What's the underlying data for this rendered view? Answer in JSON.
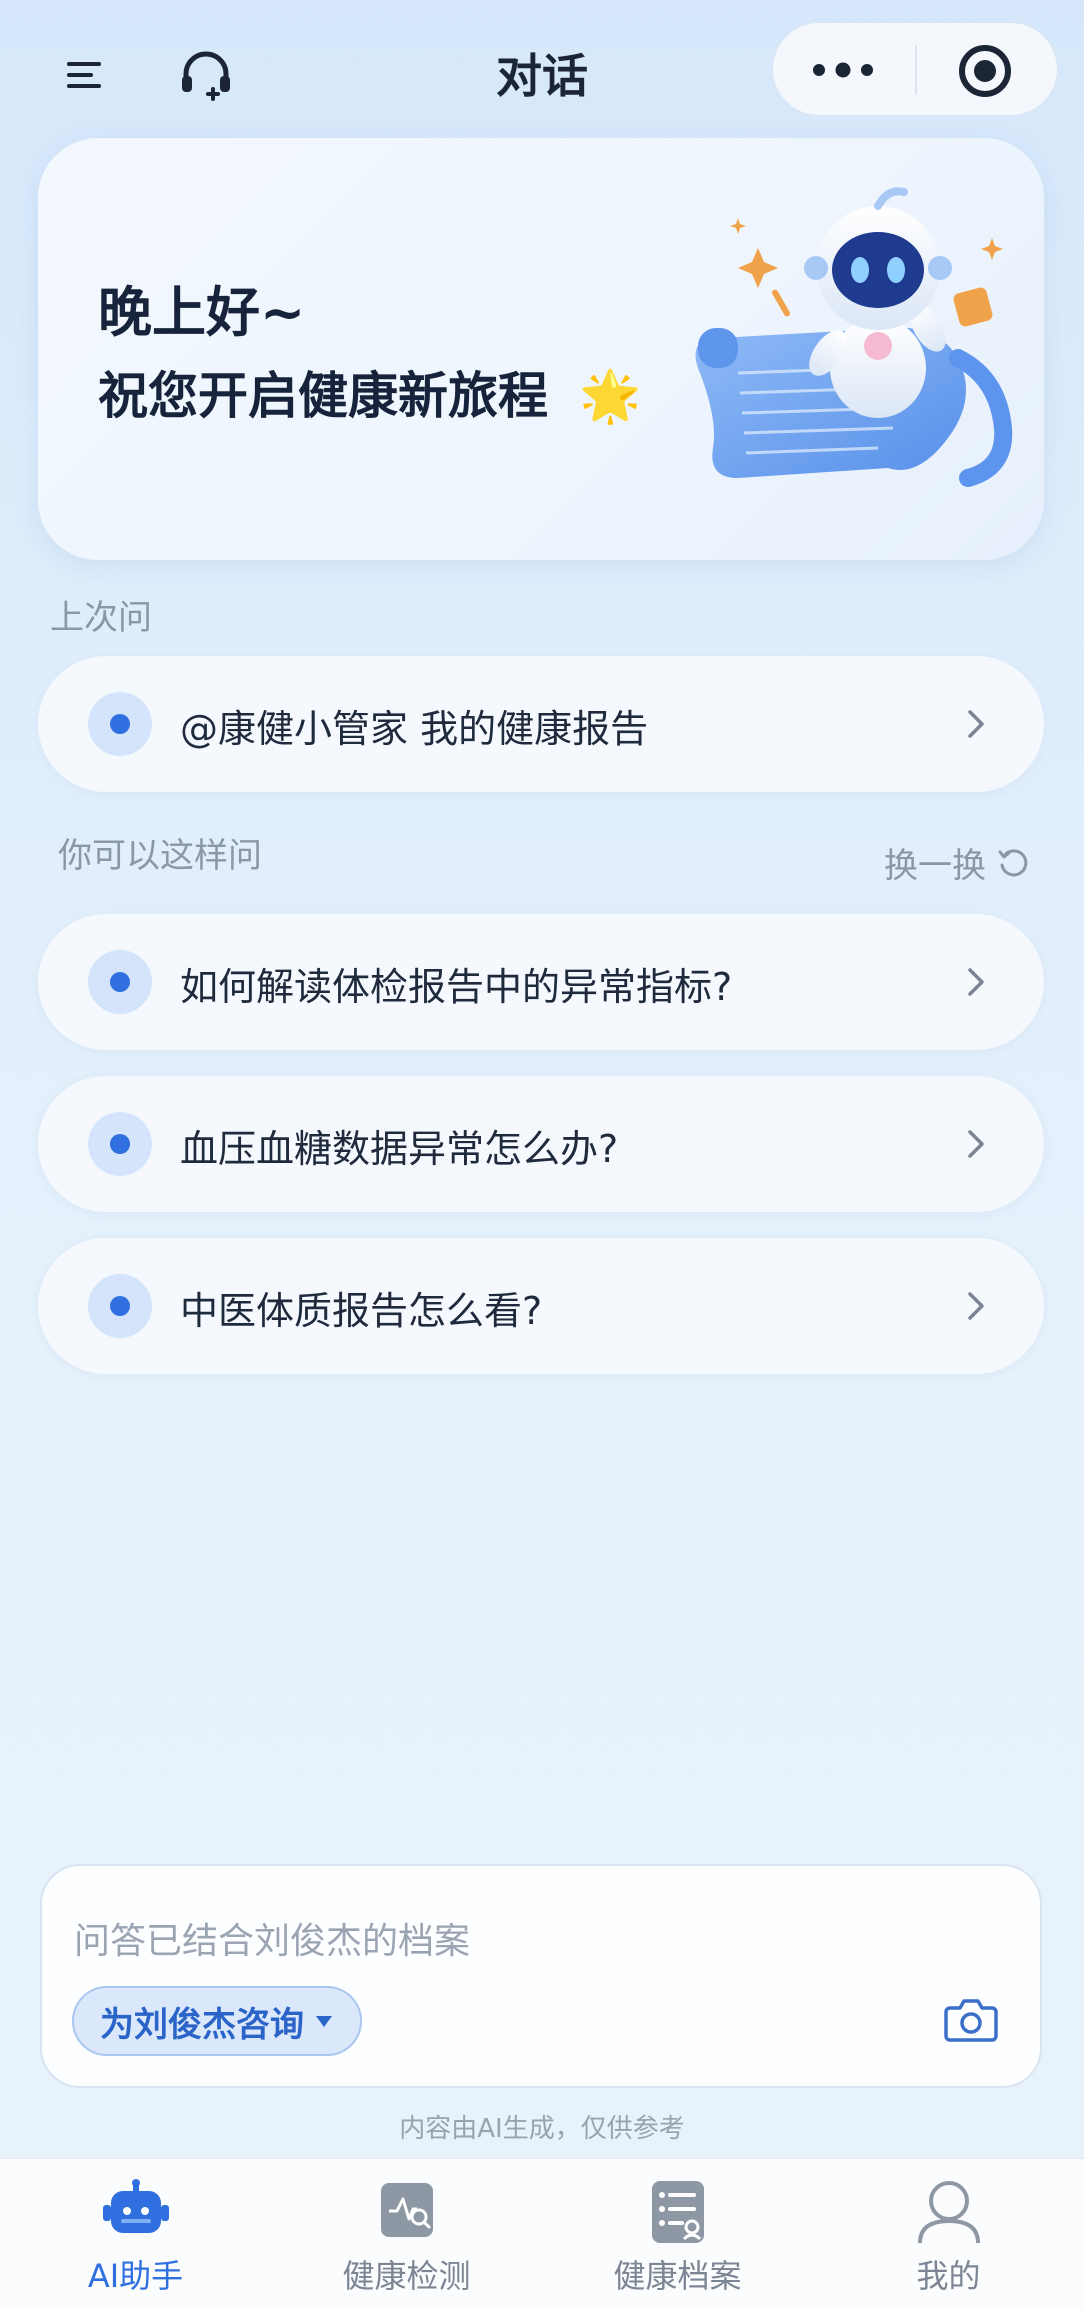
{
  "header": {
    "title": "对话",
    "menu_icon": "menu-icon",
    "service_icon": "headset-icon",
    "more_icon": "more-dots-icon",
    "record_icon": "target-icon"
  },
  "hero": {
    "greeting": "晚上好~",
    "subtitle": "祝您开启健康新旅程",
    "emoji": "🌟",
    "illustration": "robot-illustration"
  },
  "last_question": {
    "label": "上次问",
    "item": "@康健小管家 我的健康报告"
  },
  "suggestions": {
    "label": "你可以这样问",
    "refresh_label": "换一换",
    "items": [
      "如何解读体检报告中的异常指标?",
      "血压血糖数据异常怎么办?",
      "中医体质报告怎么看?"
    ]
  },
  "input": {
    "placeholder": "问答已结合刘俊杰的档案",
    "consult_label": "为刘俊杰咨询",
    "camera_icon": "camera-icon"
  },
  "disclaimer": "内容由AI生成，仅供参考",
  "nav": {
    "items": [
      {
        "label": "AI助手",
        "icon": "robot-icon",
        "active": true
      },
      {
        "label": "健康检测",
        "icon": "health-check-icon",
        "active": false
      },
      {
        "label": "健康档案",
        "icon": "health-record-icon",
        "active": false
      },
      {
        "label": "我的",
        "icon": "profile-icon",
        "active": false
      }
    ]
  },
  "colors": {
    "accent": "#2f6fe0",
    "background": "#e0eefb",
    "text": "#1f2a3d",
    "muted": "#8a97a8"
  }
}
